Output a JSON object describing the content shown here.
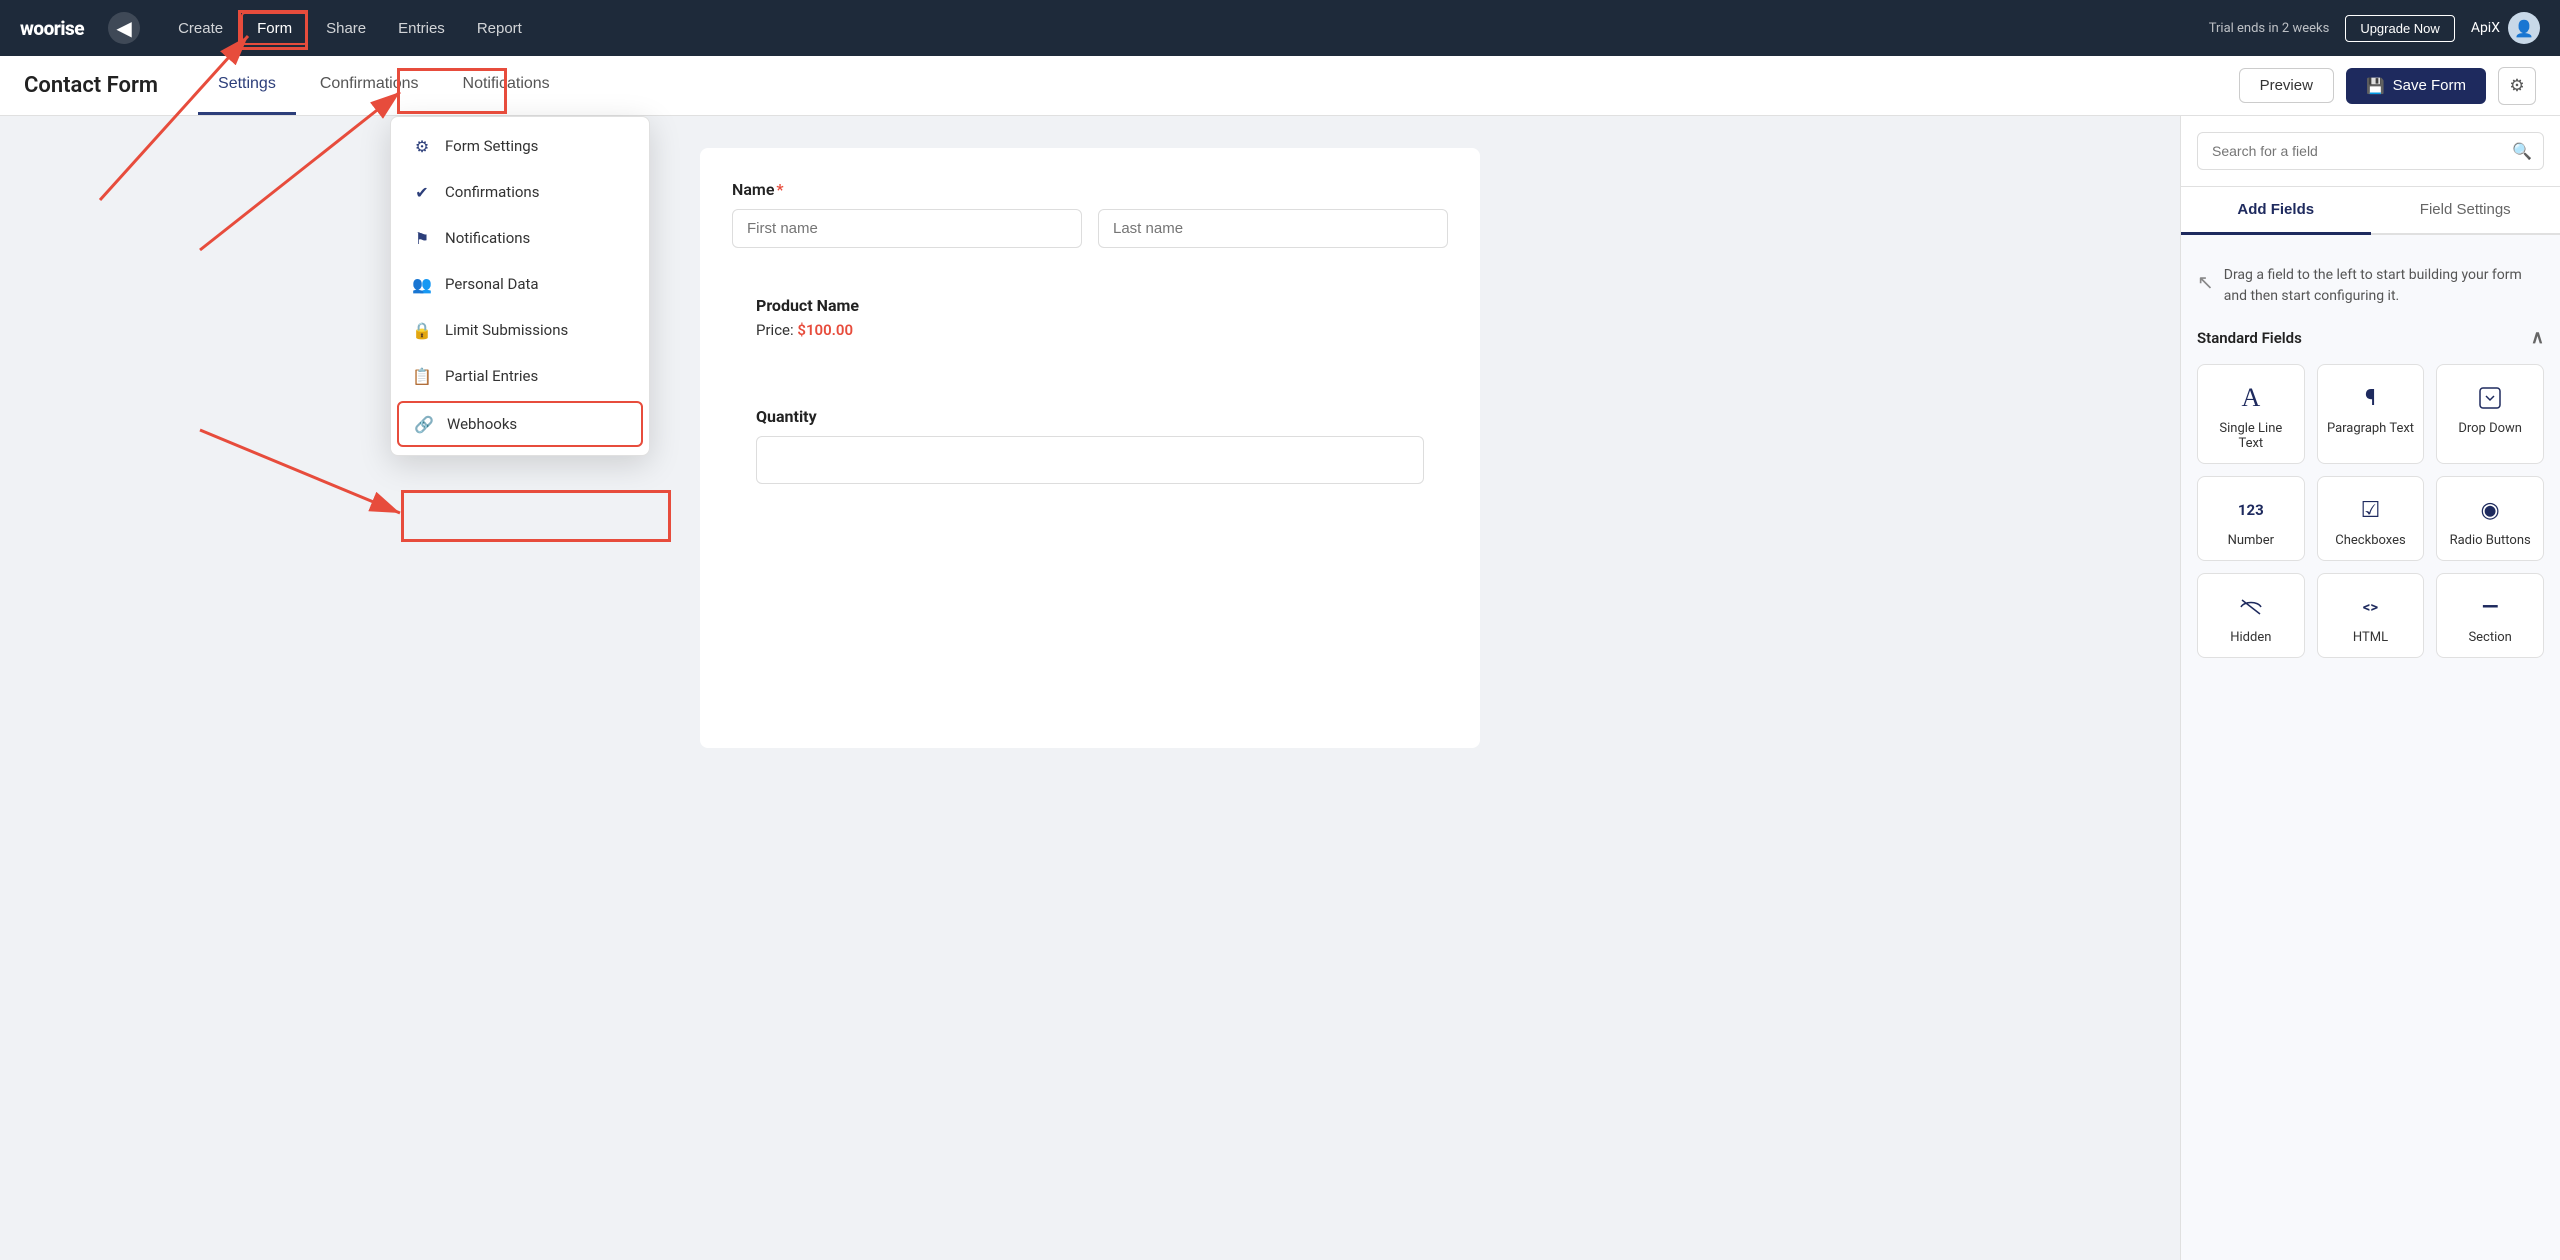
{
  "topnav": {
    "logo": "woorise",
    "back_icon": "◀",
    "nav_items": [
      {
        "label": "Create",
        "active": false
      },
      {
        "label": "Form",
        "active": true
      },
      {
        "label": "Share",
        "active": false
      },
      {
        "label": "Entries",
        "active": false
      },
      {
        "label": "Report",
        "active": false
      }
    ],
    "trial_text": "Trial ends in 2 weeks",
    "upgrade_label": "Upgrade Now",
    "user_name": "ApiX"
  },
  "subheader": {
    "form_title": "Contact Form",
    "tabs": [
      {
        "label": "Settings",
        "active": true
      },
      {
        "label": "Confirmations",
        "active": false
      },
      {
        "label": "Notifications",
        "active": false
      }
    ],
    "preview_label": "Preview",
    "save_label": "Save Form",
    "save_icon": "💾"
  },
  "dropdown_menu": {
    "items": [
      {
        "label": "Form Settings",
        "icon": "⚙"
      },
      {
        "label": "Confirmations",
        "icon": "✔"
      },
      {
        "label": "Notifications",
        "icon": "⚑"
      },
      {
        "label": "Personal Data",
        "icon": "👥"
      },
      {
        "label": "Limit Submissions",
        "icon": "🔒"
      },
      {
        "label": "Partial Entries",
        "icon": "📋"
      },
      {
        "label": "Webhooks",
        "icon": "🔗"
      }
    ]
  },
  "form": {
    "name_label": "Name",
    "name_required": "*",
    "first_name_placeholder": "First name",
    "last_name_placeholder": "Last name",
    "product_name": "Product Name",
    "price_label": "Price:",
    "price_value": "$100.00",
    "quantity_label": "Quantity"
  },
  "right_panel": {
    "search_placeholder": "Search for a field",
    "tabs": [
      {
        "label": "Add Fields",
        "active": true
      },
      {
        "label": "Field Settings",
        "active": false
      }
    ],
    "drag_hint": "Drag a field to the left to start building your form and then start configuring it.",
    "standard_fields_label": "Standard Fields",
    "fields": [
      {
        "label": "Single Line Text",
        "icon": "A"
      },
      {
        "label": "Paragraph Text",
        "icon": "¶"
      },
      {
        "label": "Drop Down",
        "icon": "▾□"
      },
      {
        "label": "Number",
        "icon": "123"
      },
      {
        "label": "Checkboxes",
        "icon": "☑"
      },
      {
        "label": "Radio Buttons",
        "icon": "◉"
      },
      {
        "label": "Hidden",
        "icon": "👁‍🗨"
      },
      {
        "label": "HTML",
        "icon": "<>"
      },
      {
        "label": "Section",
        "icon": "—"
      }
    ]
  }
}
